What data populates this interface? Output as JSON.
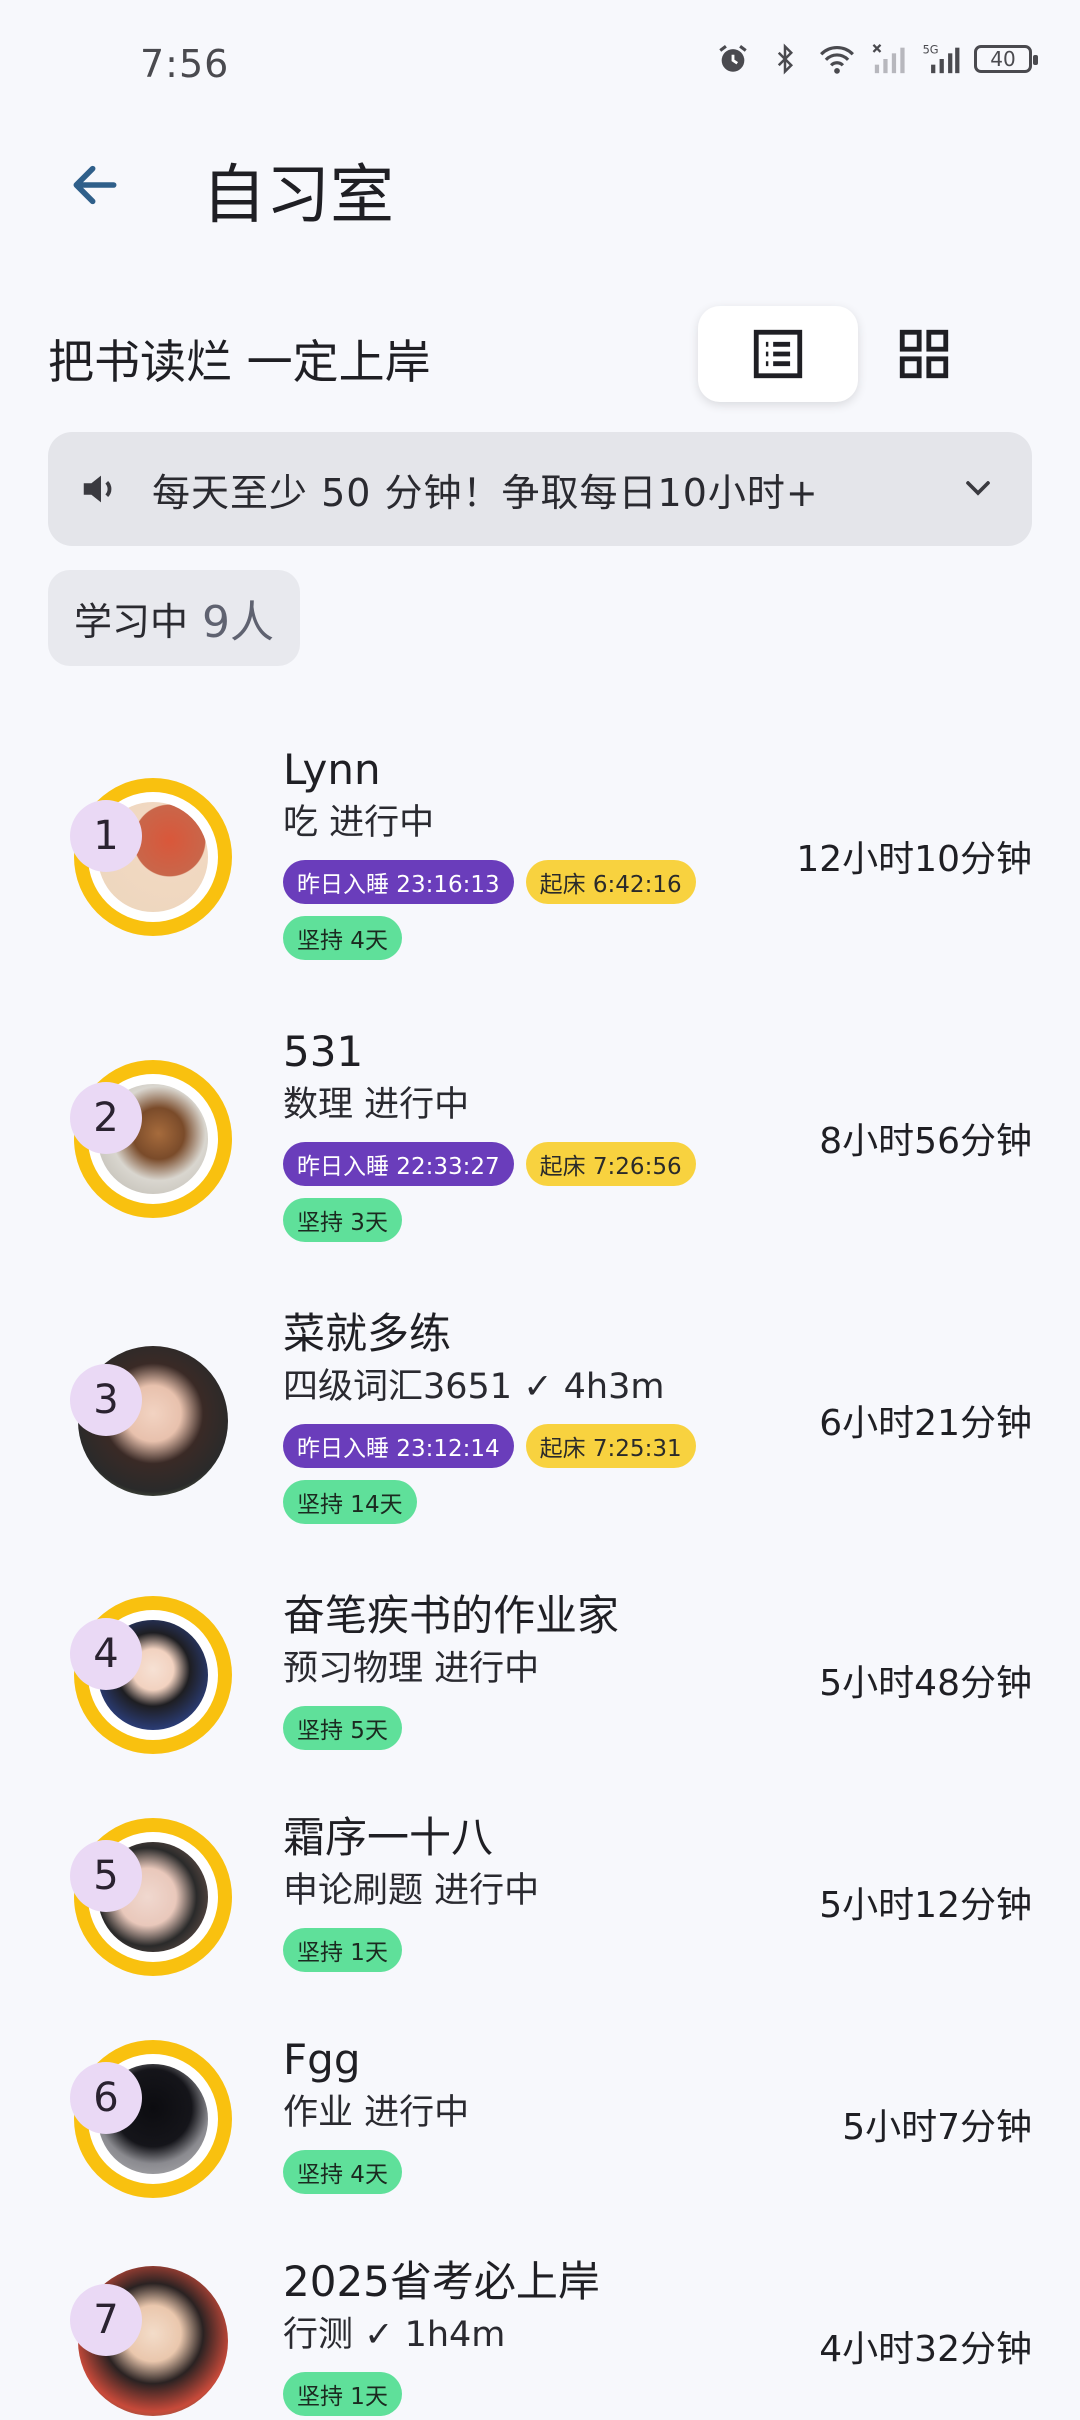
{
  "status_bar": {
    "time": "7:56",
    "battery": "40"
  },
  "header": {
    "title": "自习室"
  },
  "group": {
    "name": "把书读烂  一定上岸"
  },
  "notice": {
    "text": "每天至少 50 分钟！争取每日10小时+"
  },
  "studying": {
    "label": "学习中",
    "count": "9人"
  },
  "members": [
    {
      "rank": "1",
      "name": "Lynn",
      "activity": "吃 进行中",
      "sleep": "昨日入睡 23:16:13",
      "wake": "起床 6:42:16",
      "streak": "坚持 4天",
      "duration": "12小时10分钟"
    },
    {
      "rank": "2",
      "name": "531",
      "activity": "数理 进行中",
      "sleep": "昨日入睡 22:33:27",
      "wake": "起床 7:26:56",
      "streak": "坚持 3天",
      "duration": "8小时56分钟"
    },
    {
      "rank": "3",
      "name": "菜就多练",
      "activity": "四级词汇3651 ✓ 4h3m",
      "sleep": "昨日入睡 23:12:14",
      "wake": "起床 7:25:31",
      "streak": "坚持 14天",
      "duration": "6小时21分钟"
    },
    {
      "rank": "4",
      "name": "奋笔疾书的作业家",
      "activity": "预习物理 进行中",
      "streak": "坚持 5天",
      "duration": "5小时48分钟"
    },
    {
      "rank": "5",
      "name": "霜序一十八",
      "activity": "申论刷题 进行中",
      "streak": "坚持 1天",
      "duration": "5小时12分钟"
    },
    {
      "rank": "6",
      "name": "Fgg",
      "activity": "作业 进行中",
      "streak": "坚持 4天",
      "duration": "5小时7分钟"
    },
    {
      "rank": "7",
      "name": "2025省考必上岸",
      "activity": "行测 ✓ 1h4m",
      "streak": "坚持 1天",
      "duration": "4小时32分钟"
    }
  ]
}
